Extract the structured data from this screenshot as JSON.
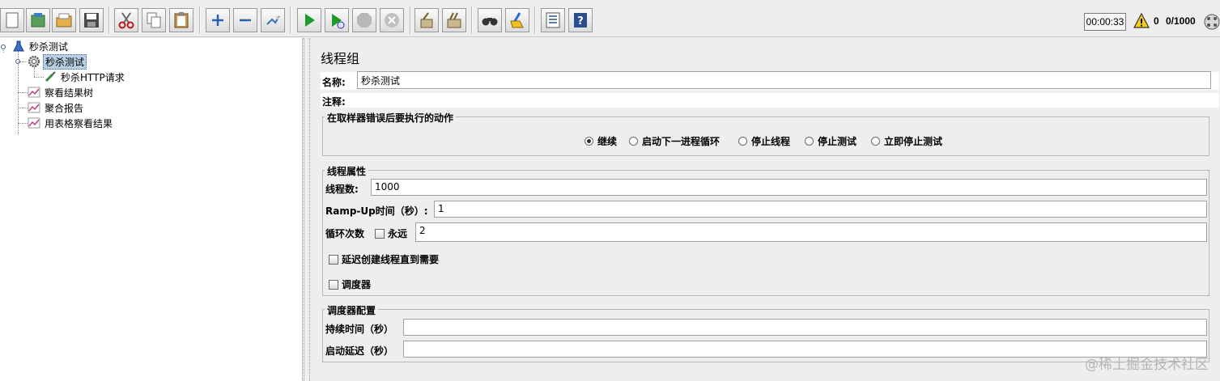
{
  "toolbar": {
    "buttons": [
      "new-icon",
      "templates-icon",
      "open-icon",
      "save-icon",
      "cut-icon",
      "copy-icon",
      "paste-icon",
      "expand-icon",
      "collapse-icon",
      "toggle-icon",
      "start-icon",
      "start-no-pauses-icon",
      "stop-icon",
      "shutdown-icon",
      "clear-icon",
      "clear-all-icon",
      "search-icon",
      "reset-search-icon",
      "function-helper-icon",
      "help-icon"
    ],
    "timer": "00:00:33",
    "error_count": "0",
    "threads": "0/1000"
  },
  "tree": {
    "root": "秒杀测试",
    "thread_group": "秒杀测试",
    "sampler": "秒杀HTTP请求",
    "listeners": [
      "察看结果树",
      "聚合报告",
      "用表格察看结果"
    ]
  },
  "panel": {
    "title": "线程组",
    "name_label": "名称:",
    "name_value": "秒杀测试",
    "comment_label": "注释:",
    "comment_value": "",
    "error_action": {
      "title": "在取样器错误后要执行的动作",
      "options": [
        "继续",
        "启动下一进程循环",
        "停止线程",
        "停止测试",
        "立即停止测试"
      ],
      "selected": "继续"
    },
    "thread_props": {
      "title": "线程属性",
      "threads_label": "线程数:",
      "threads_value": "1000",
      "rampup_label": "Ramp-Up时间（秒）:",
      "rampup_value": "1",
      "loop_label": "循环次数",
      "forever_label": "永远",
      "forever_checked": false,
      "loop_value": "2",
      "delay_label": "延迟创建线程直到需要",
      "delay_checked": false,
      "scheduler_label": "调度器",
      "scheduler_checked": false
    },
    "scheduler_config": {
      "title": "调度器配置",
      "duration_label": "持续时间（秒）",
      "duration_value": "",
      "startup_delay_label": "启动延迟（秒）",
      "startup_delay_value": ""
    }
  },
  "watermark": "@稀土掘金技术社区"
}
